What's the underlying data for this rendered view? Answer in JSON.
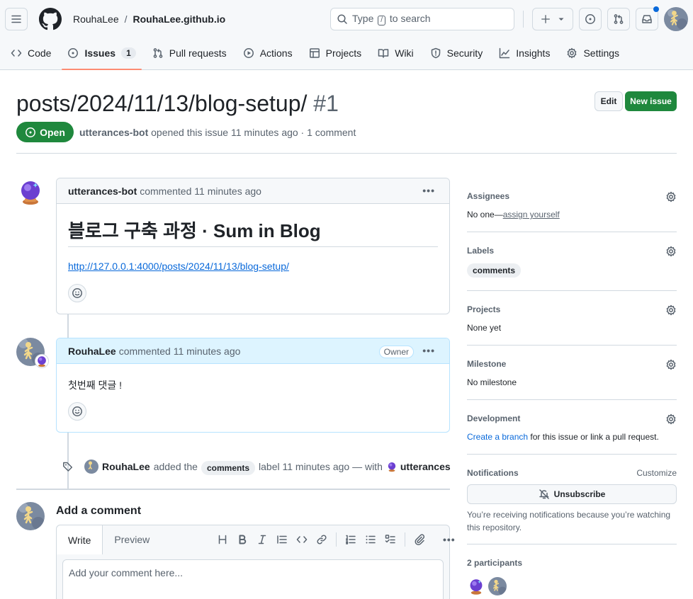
{
  "header": {
    "owner": "RouhaLee",
    "separator": "/",
    "repo": "RouhaLee.github.io",
    "search_prefix": "Type",
    "search_key": "/",
    "search_suffix": "to search"
  },
  "tabs": [
    {
      "label": "Code"
    },
    {
      "label": "Issues",
      "count": "1"
    },
    {
      "label": "Pull requests"
    },
    {
      "label": "Actions"
    },
    {
      "label": "Projects"
    },
    {
      "label": "Wiki"
    },
    {
      "label": "Security"
    },
    {
      "label": "Insights"
    },
    {
      "label": "Settings"
    }
  ],
  "issue": {
    "title": "posts/2024/11/13/blog-setup/",
    "number": "#1",
    "edit_label": "Edit",
    "new_label": "New issue",
    "state": "Open",
    "author": "utterances-bot",
    "meta": "opened this issue 11 minutes ago · 1 comment"
  },
  "comments": [
    {
      "author": "utterances-bot",
      "action": "commented 11 minutes ago",
      "heading": "블로그 구축 과정 · Sum in Blog",
      "link": "http://127.0.0.1:4000/posts/2024/11/13/blog-setup/"
    },
    {
      "author": "RouhaLee",
      "action": "commented 11 minutes ago",
      "badge": "Owner",
      "body": "첫번째 댓글 !"
    }
  ],
  "event": {
    "actor": "RouhaLee",
    "pre": "added the",
    "label": "comments",
    "post": "label 11 minutes ago — with",
    "via": "utterances"
  },
  "composer": {
    "heading": "Add a comment",
    "tab_write": "Write",
    "tab_preview": "Preview",
    "placeholder": "Add your comment here..."
  },
  "sidebar": {
    "assignees": {
      "title": "Assignees",
      "prefix": "No one—",
      "link": "assign yourself"
    },
    "labels": {
      "title": "Labels",
      "value": "comments"
    },
    "projects": {
      "title": "Projects",
      "value": "None yet"
    },
    "milestone": {
      "title": "Milestone",
      "value": "No milestone"
    },
    "development": {
      "title": "Development",
      "link": "Create a branch",
      "suffix": " for this issue or link a pull request."
    },
    "notifications": {
      "title": "Notifications",
      "customize": "Customize",
      "button": "Unsubscribe",
      "note": "You’re receiving notifications because you’re watching this repository."
    },
    "participants": {
      "title": "2 participants"
    }
  },
  "colors": {
    "accent_green": "#1f883d",
    "link_blue": "#0969da",
    "tab_underline": "#fd8c73",
    "owner_header": "#ddf4ff"
  }
}
